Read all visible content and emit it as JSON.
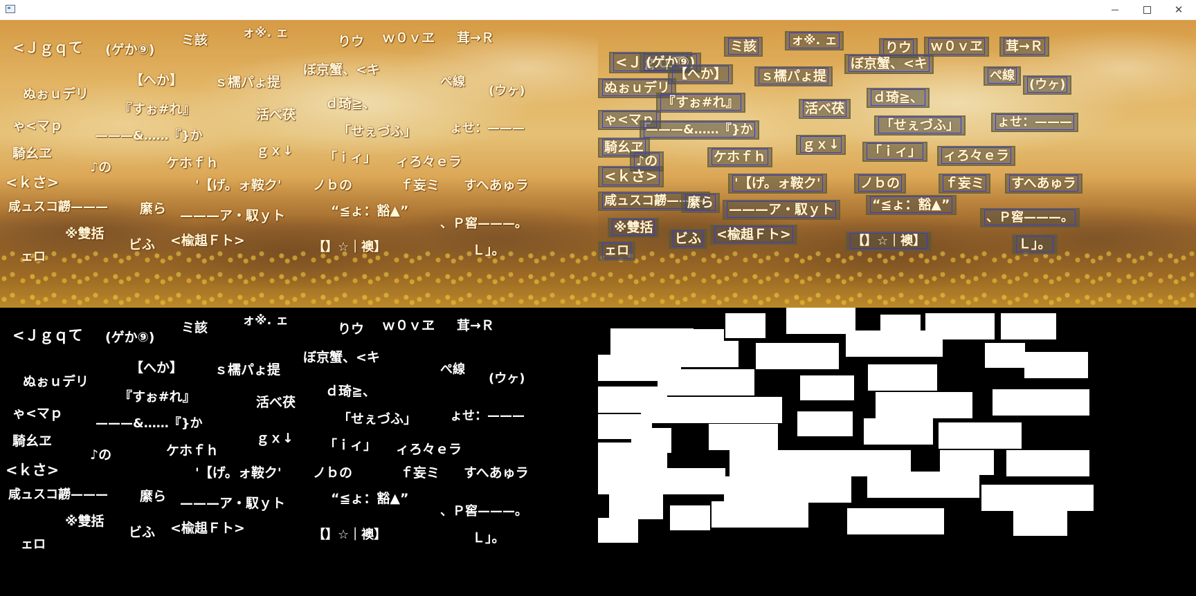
{
  "window": {
    "app_icon": "window-icon",
    "controls": {
      "minimize": "minimize-icon",
      "maximize": "maximize-icon",
      "close": "✕"
    }
  },
  "words": [
    "<Ｊｇｑて",
    "(ゲか⑨)",
    "ミ該",
    "ォ※. ェ",
    "りウ",
    "ｗ０ｖヱ",
    "茸→Ｒ",
    "【へか】",
    "ｓ檽パょ提",
    "ぼ京蟹、<キ",
    "ぺ線",
    "(ウヶ)",
    "ぬぉｕデリ",
    "『すぉ#れ』",
    "活べ茯",
    "ｄ琦≧、",
    "ゃ<マｐ",
    "———&……『}か",
    "「せぇづふ」",
    "ょせ：———",
    "騎幺ヱ",
    "ｇｘ↓",
    "「ｉィ」",
    "ィろ々ｅラ",
    "♪の",
    "ケホｆｈ",
    "<ｋさ>",
    "'【げ。ォ鞍ク'",
    "ノｂの",
    "ｆ妄ミ",
    "すへあゅラ",
    "咸ュスコ髝———",
    "縻ら",
    "———ア・馭ｙト",
    "“≦ょ：豁▲”",
    "、Ｐ窖———。",
    "※雙括",
    "ビふ",
    "<楡趄Ｆト>",
    "【】☆｜襖】",
    "Ｌ」。",
    "ェロ"
  ]
}
